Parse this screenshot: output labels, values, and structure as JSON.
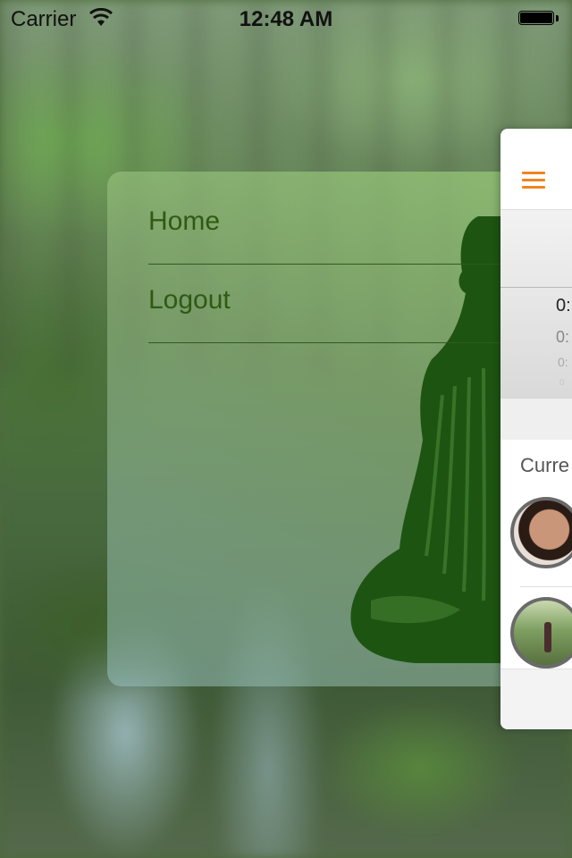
{
  "status_bar": {
    "carrier": "Carrier",
    "time": "12:48 AM",
    "battery_level": 1.0
  },
  "menu": {
    "items": [
      {
        "label": "Home"
      },
      {
        "label": "Logout"
      }
    ],
    "text_color": "#2f5a14"
  },
  "main_view": {
    "accent_color": "#f0841e",
    "picker_values": [
      "0:",
      "0:",
      "0:",
      "0"
    ],
    "section_title": "Curre"
  },
  "icons": [
    "wifi-icon",
    "battery-icon",
    "hamburger-menu-icon",
    "buddha-silhouette"
  ]
}
